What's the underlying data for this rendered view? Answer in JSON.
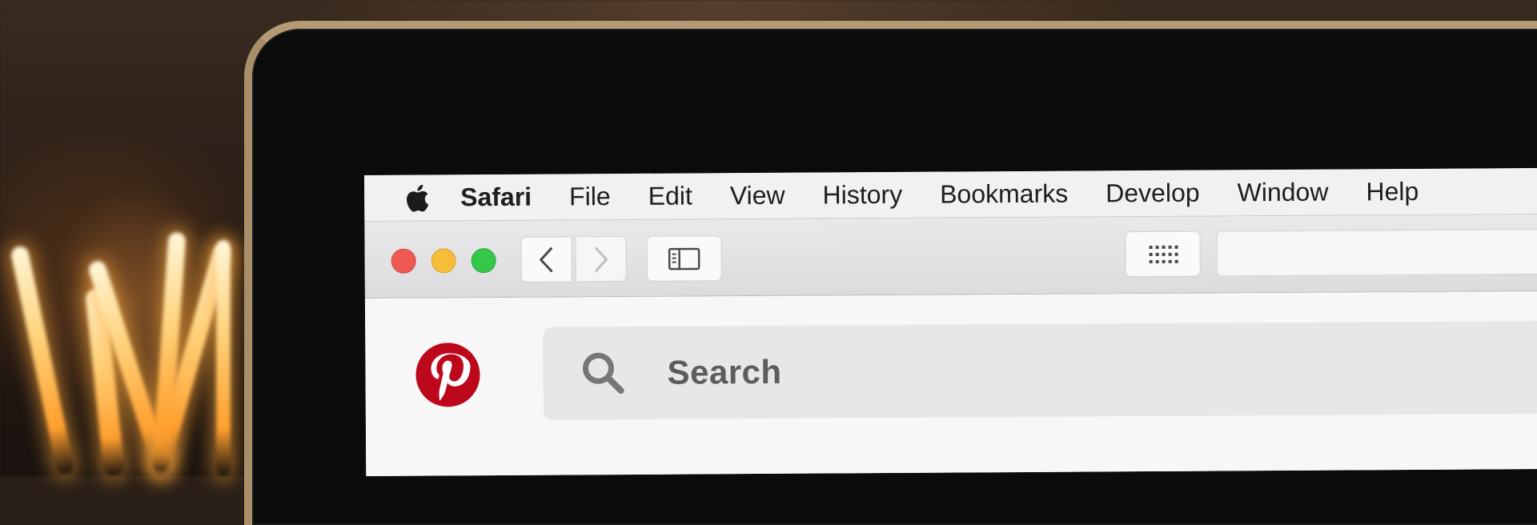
{
  "menubar": {
    "apple_icon": "apple-logo-icon",
    "items": [
      "Safari",
      "File",
      "Edit",
      "View",
      "History",
      "Bookmarks",
      "Develop",
      "Window",
      "Help"
    ]
  },
  "toolbar": {
    "traffic_lights": {
      "close": "#ee5a52",
      "minimize": "#f5bd3a",
      "zoom": "#36c84a"
    },
    "back_icon": "chevron-left-icon",
    "forward_icon": "chevron-right-icon",
    "sidebar_icon": "sidebar-icon",
    "top_sites_icon": "grid-icon",
    "address_value": ""
  },
  "page": {
    "logo": "pinterest-logo-icon",
    "brand_color": "#bd081c",
    "search_placeholder": "Search"
  }
}
